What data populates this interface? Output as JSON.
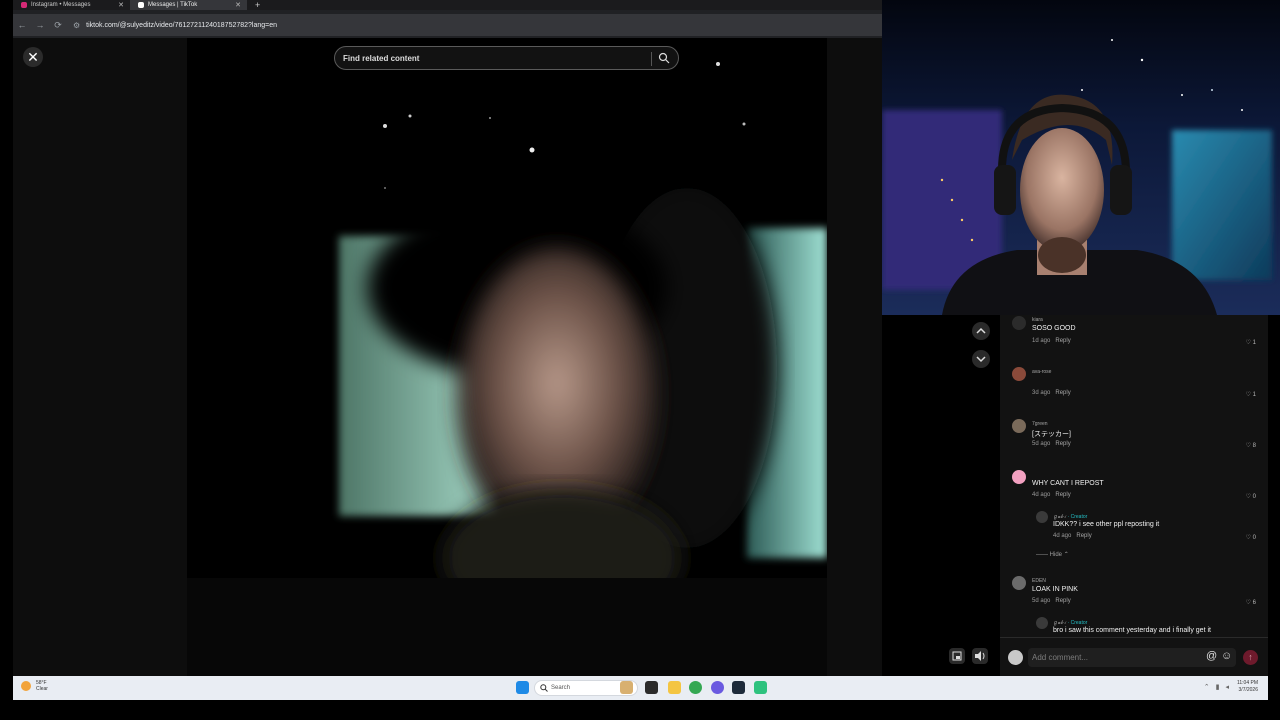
{
  "browser": {
    "tabs": [
      {
        "label": "Instagram • Messages",
        "active": false,
        "favicon_color": "#d62976"
      },
      {
        "label": "Messages | TikTok",
        "active": true,
        "favicon_color": "#ffffff"
      }
    ],
    "new_tab": "+",
    "url": "tiktok.com/@sulyeditz/video/7612721124018752782?lang=en"
  },
  "viewer": {
    "close_icon": "✕",
    "search_placeholder": "Find related content"
  },
  "comments": [
    {
      "user": "kiara",
      "text": "SOSO GOOD",
      "time": "1d ago",
      "reply": "Reply",
      "likes": "1",
      "avatar": "#2b2b2b"
    },
    {
      "user": "ava-rose",
      "text": "",
      "time": "3d ago",
      "reply": "Reply",
      "likes": "1",
      "avatar": "#8a4a3a"
    },
    {
      "user": "7green",
      "text": "[ステッカー]",
      "time": "5d ago",
      "reply": "Reply",
      "likes": "8",
      "avatar": "#7a6a5a"
    },
    {
      "user": "",
      "text": "WHY CANT I REPOST",
      "time": "4d ago",
      "reply": "Reply",
      "likes": "0",
      "avatar": "#f2a0c0"
    },
    {
      "user": "EDEN",
      "text": "LOAK IN PINK",
      "time": "5d ago",
      "reply": "Reply",
      "likes": "6",
      "avatar": "#6a6a6a"
    }
  ],
  "replies": [
    {
      "user": "ℊ𝒶𝒷·𝒾",
      "creator": "· Creator",
      "text": "IDKK?? i see other ppl reposting it",
      "time": "4d ago",
      "reply": "Reply",
      "likes": "0"
    },
    {
      "user": "ℊ𝒶𝒷·𝒾",
      "creator": "· Creator",
      "text": "bro i saw this comment yesterday and i finally get it"
    }
  ],
  "hide_label": "Hide",
  "add_comment": {
    "placeholder": "Add comment...",
    "at": "@",
    "emoji": "☺",
    "send": "↑"
  },
  "taskbar": {
    "weather_temp": "58°F",
    "weather_desc": "Clear",
    "search": "Search",
    "time": "11:04 PM",
    "date": "3/7/2026"
  },
  "colors": {
    "accent_creator": "#24c0c7",
    "send_button": "#6e1a2c"
  }
}
